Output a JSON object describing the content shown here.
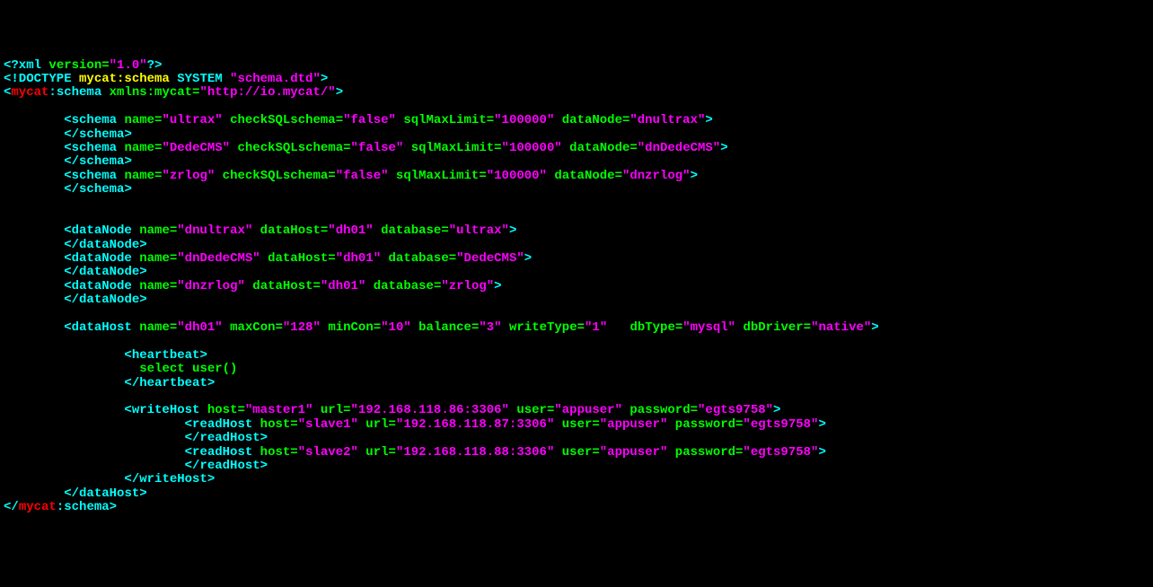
{
  "xml_decl": {
    "open": "<?xml ",
    "attr": "version=",
    "val": "\"1.0\"",
    "close": "?>"
  },
  "doctype": {
    "open": "<!DOCTYPE ",
    "name": "mycat:schema ",
    "system": "SYSTEM ",
    "dtd": "\"schema.dtd\"",
    "close": ">"
  },
  "root": {
    "open_lt": "<",
    "ns_prefix": "mycat",
    "colon": ":",
    "local": "schema ",
    "xmlns": "xmlns:mycat=",
    "xmlns_val": "\"http://io.mycat/\"",
    "gt": ">",
    "close_open": "</",
    "close_gt": ">"
  },
  "schemas": [
    {
      "tag": "schema",
      "name_attr": "name=",
      "name_val": "\"ultrax\"",
      "check_attr": " checkSQLschema=",
      "check_val": "\"false\"",
      "sql_attr": " sqlMaxLimit=",
      "sql_val": "\"100000\"",
      "dn_attr": " dataNode=",
      "dn_val": "\"dnultrax\""
    },
    {
      "tag": "schema",
      "name_attr": "name=",
      "name_val": "\"DedeCMS\"",
      "check_attr": " checkSQLschema=",
      "check_val": "\"false\"",
      "sql_attr": " sqlMaxLimit=",
      "sql_val": "\"100000\"",
      "dn_attr": " dataNode=",
      "dn_val": "\"dnDedeCMS\""
    },
    {
      "tag": "schema",
      "name_attr": "name=",
      "name_val": "\"zrlog\"",
      "check_attr": " checkSQLschema=",
      "check_val": "\"false\"",
      "sql_attr": " sqlMaxLimit=",
      "sql_val": "\"100000\"",
      "dn_attr": " dataNode=",
      "dn_val": "\"dnzrlog\""
    }
  ],
  "datanodes": [
    {
      "tag": "dataNode",
      "name_attr": "name=",
      "name_val": "\"dnultrax\"",
      "dh_attr": " dataHost=",
      "dh_val": "\"dh01\"",
      "db_attr": " database=",
      "db_val": "\"ultrax\""
    },
    {
      "tag": "dataNode",
      "name_attr": "name=",
      "name_val": "\"dnDedeCMS\"",
      "dh_attr": " dataHost=",
      "dh_val": "\"dh01\"",
      "db_attr": " database=",
      "db_val": "\"DedeCMS\""
    },
    {
      "tag": "dataNode",
      "name_attr": "name=",
      "name_val": "\"dnzrlog\"",
      "dh_attr": " dataHost=",
      "dh_val": "\"dh01\"",
      "db_attr": " database=",
      "db_val": "\"zrlog\""
    }
  ],
  "datahost": {
    "tag": "dataHost",
    "name_attr": "name=",
    "name_val": "\"dh01\"",
    "maxcon_attr": " maxCon=",
    "maxcon_val": "\"128\"",
    "mincon_attr": " minCon=",
    "mincon_val": "\"10\"",
    "balance_attr": " balance=",
    "balance_val": "\"3\"",
    "writetype_attr": " writeType=",
    "writetype_val": "\"1\"",
    "dbtype_attr": "   dbType=",
    "dbtype_val": "\"mysql\"",
    "dbdriver_attr": " dbDriver=",
    "dbdriver_val": "\"native\""
  },
  "heartbeat": {
    "tag": "heartbeat",
    "text": "select user()"
  },
  "writehost": {
    "tag": "writeHost",
    "host_attr": "host=",
    "host_val": "\"master1\"",
    "url_attr": " url=",
    "url_val": "\"192.168.118.86:3306\"",
    "user_attr": " user=",
    "user_val": "\"appuser\"",
    "pw_attr": " password=",
    "pw_val": "\"egts9758\""
  },
  "readhosts": [
    {
      "tag": "readHost",
      "host_attr": "host=",
      "host_val": "\"slave1\"",
      "url_attr": " url=",
      "url_val": "\"192.168.118.87:3306\"",
      "user_attr": " user=",
      "user_val": "\"appuser\"",
      "pw_attr": " password=",
      "pw_val": "\"egts9758\""
    },
    {
      "tag": "readHost",
      "host_attr": "host=",
      "host_val": "\"slave2\"",
      "url_attr": " url=",
      "url_val": "\"192.168.118.88:3306\"",
      "user_attr": " user=",
      "user_val": "\"appuser\"",
      "pw_attr": " password=",
      "pw_val": "\"egts9758\""
    }
  ],
  "indent1": "        ",
  "indent2": "                ",
  "indent3": "                        "
}
